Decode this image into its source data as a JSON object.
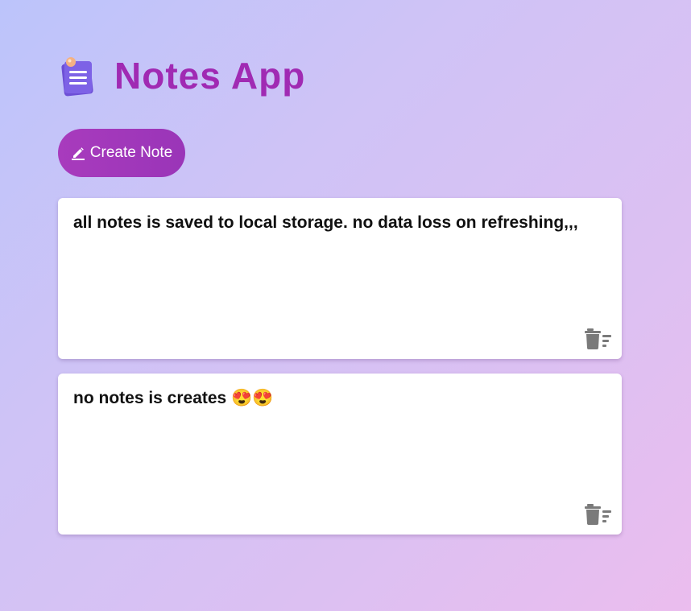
{
  "app": {
    "title": "Notes App",
    "icon": "notepad-icon"
  },
  "toolbar": {
    "create_label": "Create Note",
    "create_icon": "pencil-icon"
  },
  "notes": [
    {
      "text": "all notes is saved to local storage. no data loss on refreshing,,,",
      "delete_icon": "delete-icon"
    },
    {
      "text": "no notes is creates 😍😍",
      "delete_icon": "delete-icon"
    }
  ],
  "colors": {
    "title": "#a02ab3",
    "button": "#a236b9",
    "card": "#ffffff",
    "icon_gray": "#7a7a7a"
  }
}
